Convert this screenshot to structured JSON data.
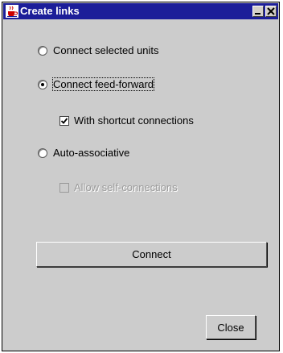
{
  "window": {
    "title": "Create links",
    "title_icon": "java-cup-icon"
  },
  "options": {
    "connect_selected": {
      "label": "Connect selected units",
      "checked": false
    },
    "connect_feed_forward": {
      "label": "Connect feed-forward",
      "checked": true
    },
    "shortcut_connections": {
      "label": "With shortcut connections",
      "checked": true
    },
    "auto_associative": {
      "label": "Auto-associative",
      "checked": false
    },
    "allow_self_connections": {
      "label": "Allow self-connections",
      "checked": false,
      "enabled": false
    }
  },
  "buttons": {
    "connect": "Connect",
    "close": "Close"
  },
  "colors": {
    "titlebar": "#1c1e99",
    "background": "#cccccc",
    "disabled_text": "#9a9a9a"
  }
}
